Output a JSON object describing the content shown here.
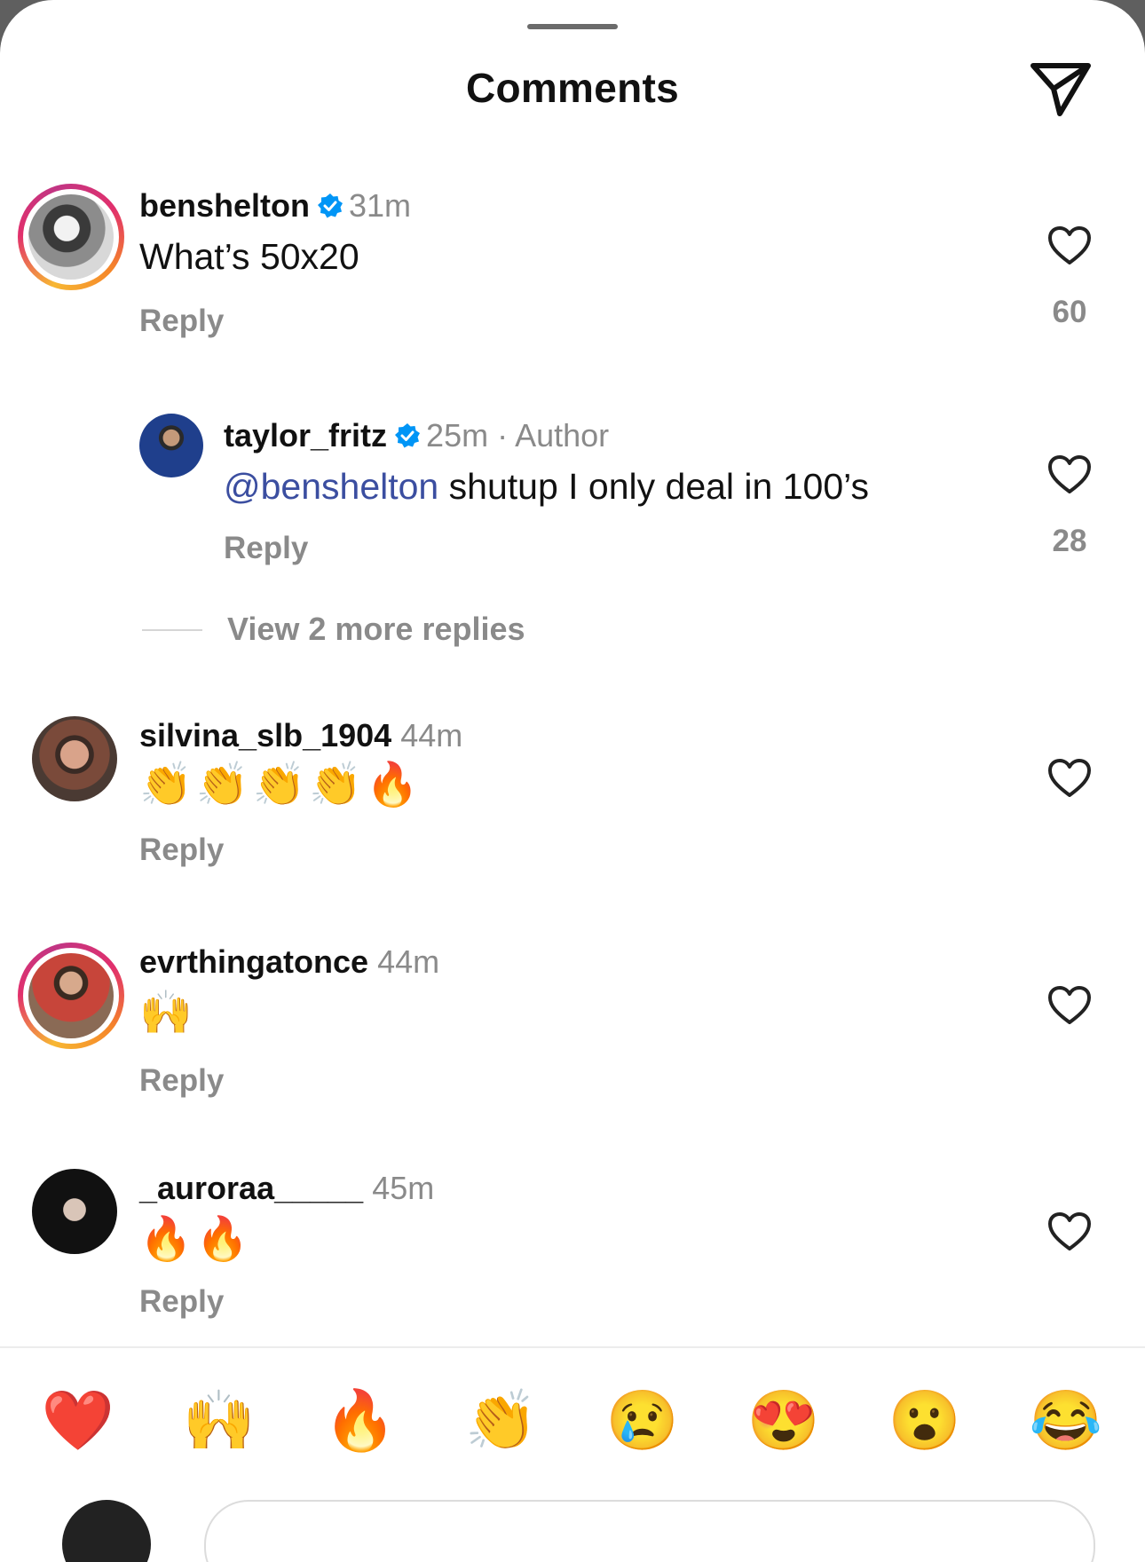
{
  "sheet": {
    "title": "Comments",
    "share_icon": "paper-plane-icon"
  },
  "comments": [
    {
      "username": "benshelton",
      "verified": true,
      "time": "31m",
      "text": "What’s 50x20",
      "reply_label": "Reply",
      "likes": "60",
      "story_ring": true
    },
    {
      "username": "taylor_fritz",
      "verified": true,
      "time": "25m · Author",
      "mention": "@benshelton",
      "text": " shutup I only deal in 100’s",
      "reply_label": "Reply",
      "likes": "28"
    },
    {
      "username": "silvina_slb_1904",
      "time": "44m",
      "text": "👏👏👏👏🔥",
      "reply_label": "Reply"
    },
    {
      "username": "evrthingatonce",
      "time": "44m",
      "text": "🙌",
      "reply_label": "Reply",
      "story_ring": true
    },
    {
      "username": "_auroraa_____",
      "time": "45m",
      "text": "🔥🔥",
      "reply_label": "Reply"
    }
  ],
  "view_more": "View 2 more replies",
  "reactions": [
    "❤️",
    "🙌",
    "🔥",
    "👏",
    "😢",
    "😍",
    "😮",
    "😂"
  ],
  "colors": {
    "verified_blue": "#0095f6",
    "mention": "#3b4ea0",
    "muted": "#8a8a8a"
  }
}
